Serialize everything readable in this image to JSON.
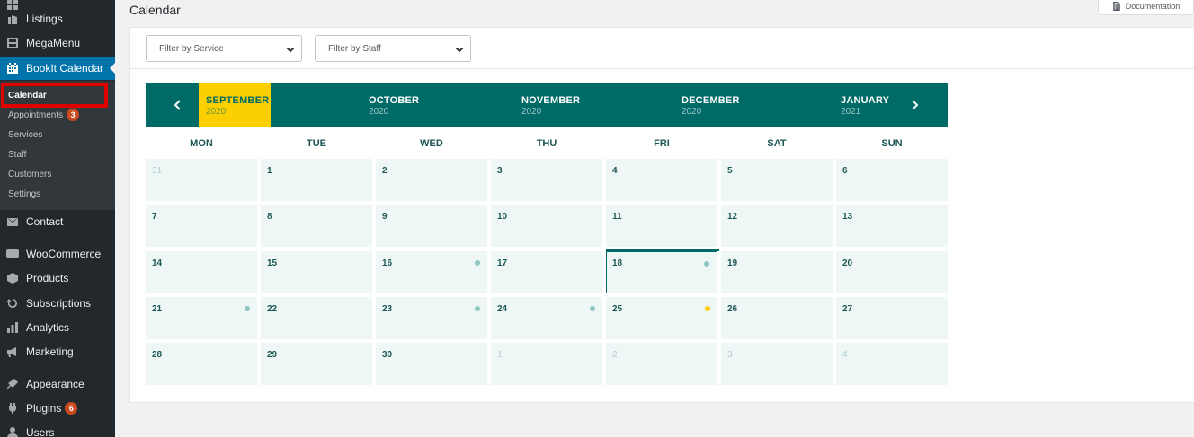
{
  "sidebar": {
    "items": [
      {
        "label": "Listings",
        "icon": "listings-icon"
      },
      {
        "label": "MegaMenu",
        "icon": "megamenu-icon"
      },
      {
        "label": "BookIt Calendar",
        "icon": "calendar-icon"
      },
      {
        "label": "Contact",
        "icon": "mail-icon"
      },
      {
        "label": "WooCommerce",
        "icon": "woocommerce-icon"
      },
      {
        "label": "Products",
        "icon": "products-icon"
      },
      {
        "label": "Subscriptions",
        "icon": "subscriptions-icon"
      },
      {
        "label": "Analytics",
        "icon": "analytics-icon"
      },
      {
        "label": "Marketing",
        "icon": "marketing-icon"
      },
      {
        "label": "Appearance",
        "icon": "appearance-icon"
      },
      {
        "label": "Plugins",
        "icon": "plugins-icon",
        "badge": "6"
      },
      {
        "label": "Users",
        "icon": "users-icon"
      }
    ],
    "submenu": [
      {
        "label": "Calendar",
        "current": true
      },
      {
        "label": "Appointments",
        "badge": "3"
      },
      {
        "label": "Services"
      },
      {
        "label": "Staff"
      },
      {
        "label": "Customers"
      },
      {
        "label": "Settings"
      }
    ]
  },
  "header": {
    "title": "Calendar",
    "documentation_label": "Documentation"
  },
  "filters": {
    "service": "Filter by Service",
    "staff": "Filter by Staff"
  },
  "months": [
    {
      "name": "SEPTEMBER",
      "year": "2020",
      "selected": true
    },
    {
      "name": "OCTOBER",
      "year": "2020"
    },
    {
      "name": "NOVEMBER",
      "year": "2020"
    },
    {
      "name": "DECEMBER",
      "year": "2020"
    },
    {
      "name": "JANUARY",
      "year": "2021"
    }
  ],
  "weekdays": [
    "MON",
    "TUE",
    "WED",
    "THU",
    "FRI",
    "SAT",
    "SUN"
  ],
  "colors": {
    "primary": "#006a66",
    "accent": "#fcd000",
    "cell_bg": "#eef7f6",
    "dot_default": "#8fc7c2",
    "dot_highlight": "#fcd000",
    "wp_blue": "#0073aa"
  },
  "weeks": [
    [
      {
        "day": "31",
        "muted": true
      },
      {
        "day": "1"
      },
      {
        "day": "2"
      },
      {
        "day": "3"
      },
      {
        "day": "4"
      },
      {
        "day": "5"
      },
      {
        "day": "6"
      }
    ],
    [
      {
        "day": "7"
      },
      {
        "day": "8"
      },
      {
        "day": "9"
      },
      {
        "day": "10"
      },
      {
        "day": "11"
      },
      {
        "day": "12"
      },
      {
        "day": "13"
      }
    ],
    [
      {
        "day": "14"
      },
      {
        "day": "15"
      },
      {
        "day": "16",
        "dot": "default"
      },
      {
        "day": "17"
      },
      {
        "day": "18",
        "today": true,
        "dot": "default"
      },
      {
        "day": "19"
      },
      {
        "day": "20"
      }
    ],
    [
      {
        "day": "21",
        "dot": "default"
      },
      {
        "day": "22"
      },
      {
        "day": "23",
        "dot": "default"
      },
      {
        "day": "24",
        "dot": "default"
      },
      {
        "day": "25",
        "dot": "highlight"
      },
      {
        "day": "26"
      },
      {
        "day": "27"
      }
    ],
    [
      {
        "day": "28"
      },
      {
        "day": "29"
      },
      {
        "day": "30"
      },
      {
        "day": "1",
        "muted": true
      },
      {
        "day": "2",
        "muted": true
      },
      {
        "day": "3",
        "muted": true
      },
      {
        "day": "4",
        "muted": true
      }
    ]
  ]
}
